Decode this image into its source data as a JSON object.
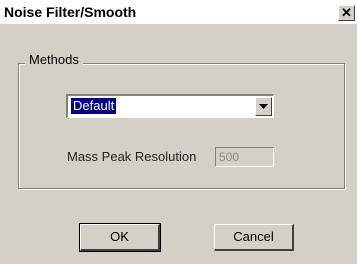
{
  "window": {
    "title": "Noise Filter/Smooth",
    "close_glyph": "✕"
  },
  "methods": {
    "group_label": "Methods",
    "selected": "Default",
    "resolution_label": "Mass Peak Resolution",
    "resolution_value": "500"
  },
  "buttons": {
    "ok": "OK",
    "cancel": "Cancel"
  }
}
